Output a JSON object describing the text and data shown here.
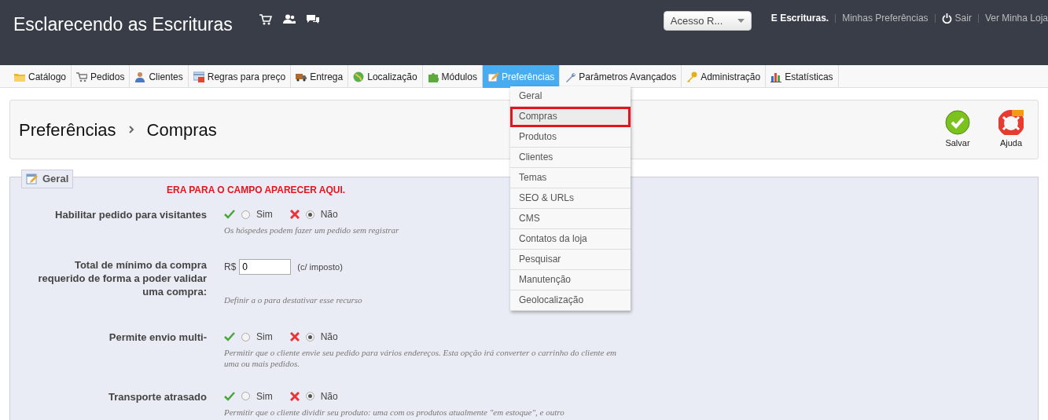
{
  "header": {
    "title": "Esclarecendo as Escrituras",
    "shop_select": {
      "value": "Acesso R..."
    },
    "user_links": [
      {
        "text": "E Escrituras.",
        "kind": "user"
      },
      {
        "text": "Minhas Preferências",
        "kind": "link"
      },
      {
        "text": "Sair",
        "kind": "logout"
      },
      {
        "text": "Ver Minha Loja",
        "kind": "link"
      }
    ]
  },
  "tabs": [
    {
      "label": "Catálogo",
      "selected": false
    },
    {
      "label": "Pedidos",
      "selected": false
    },
    {
      "label": "Clientes",
      "selected": false
    },
    {
      "label": "Regras para preço",
      "selected": false
    },
    {
      "label": "Entrega",
      "selected": false
    },
    {
      "label": "Localização",
      "selected": false
    },
    {
      "label": "Módulos",
      "selected": false
    },
    {
      "label": "Preferências",
      "selected": true
    },
    {
      "label": "Parâmetros Avançados",
      "selected": false
    },
    {
      "label": "Administração",
      "selected": false
    },
    {
      "label": "Estatísticas",
      "selected": false
    }
  ],
  "submenu": {
    "items": [
      {
        "label": "Geral",
        "selected": false
      },
      {
        "label": "Compras",
        "selected": true
      },
      {
        "label": "Produtos",
        "selected": false
      },
      {
        "label": "Clientes",
        "selected": false
      },
      {
        "label": "Temas",
        "selected": false
      },
      {
        "label": "SEO & URLs",
        "selected": false
      },
      {
        "label": "CMS",
        "selected": false
      },
      {
        "label": "Contatos da loja",
        "selected": false
      },
      {
        "label": "Pesquisar",
        "selected": false
      },
      {
        "label": "Manutenção",
        "selected": false
      },
      {
        "label": "Geolocalização",
        "selected": false
      }
    ]
  },
  "toolbar": {
    "breadcrumb": [
      "Preferências",
      "Compras"
    ],
    "buttons": [
      {
        "label": "Salvar",
        "kind": "save"
      },
      {
        "label": "Ajuda",
        "kind": "help"
      }
    ]
  },
  "fieldset": {
    "legend": "Geral",
    "notice": "ERA PARA O CAMPO APARECER AQUI.",
    "fields": [
      {
        "kind": "yesno",
        "label": "Habilitar pedido para visitantes",
        "options": [
          {
            "label": "Sim",
            "selected": false
          },
          {
            "label": "Não",
            "selected": true
          }
        ],
        "hint": "Os hóspedes podem fazer um pedido sem registrar"
      },
      {
        "kind": "price",
        "label": "Total de mínimo da compra requerido de forma a poder validar uma compra:",
        "currency": "R$",
        "value": "0",
        "suffix": "(c/ imposto)",
        "hint": "Definir a o para destativar esse recurso"
      },
      {
        "kind": "yesno",
        "label": "Permite envio multi-",
        "options": [
          {
            "label": "Sim",
            "selected": false
          },
          {
            "label": "Não",
            "selected": true
          }
        ],
        "hint": "Permitir que o cliente envie seu pedido para vários endereços. Esta opção irá converter o carrinho do cliente em uma ou mais pedidos."
      },
      {
        "kind": "yesno",
        "label": "Transporte atrasado",
        "options": [
          {
            "label": "Sim",
            "selected": false
          },
          {
            "label": "Não",
            "selected": true
          }
        ],
        "hint": "Permitir que o cliente dividir seu produto: uma com os produtos atualmente \"em estoque\", e outro"
      }
    ]
  }
}
